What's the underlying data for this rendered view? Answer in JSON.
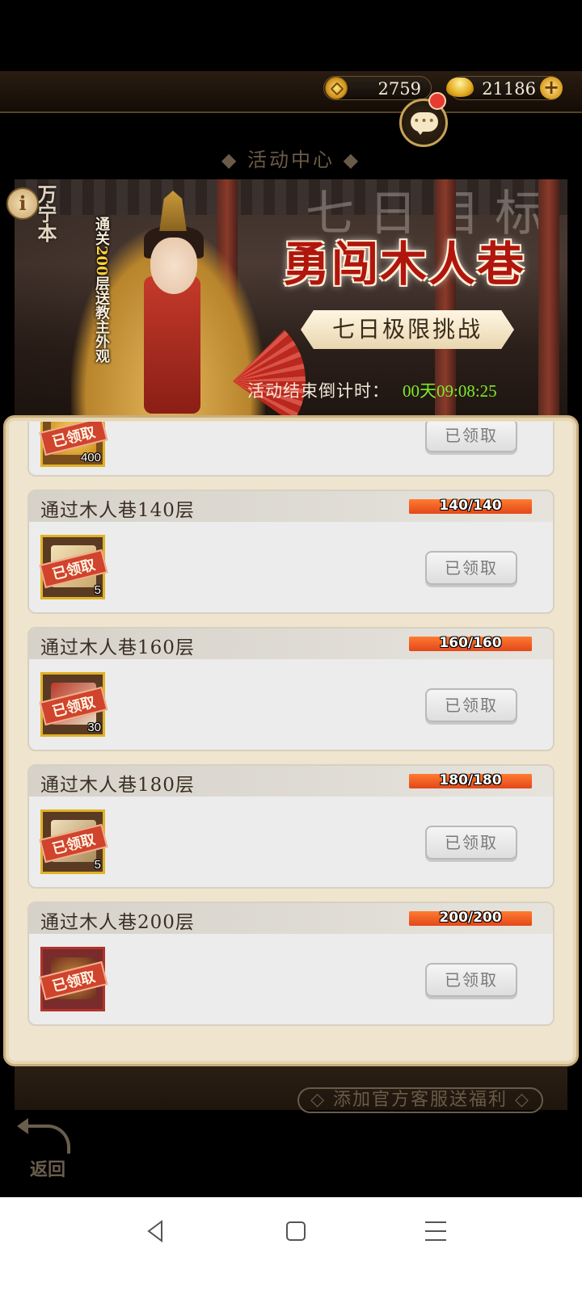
{
  "header": {
    "coins": "2759",
    "ingots": "21186",
    "section_title": "◆ 活动中心 ◆"
  },
  "banner": {
    "promo_vertical_a": "通关",
    "promo_vertical_hl": "200",
    "promo_vertical_b": "层送教主外观",
    "title": "勇闯木人巷",
    "subtitle": "七日极限挑战",
    "countdown_label": "活动结束倒计时：",
    "countdown_value": "00天09:08:25",
    "info_icon": "i"
  },
  "tasks": [
    {
      "name": "",
      "progress": "",
      "qty": "400",
      "stamp": "已领取",
      "button": "已领取"
    },
    {
      "name": "通过木人巷140层",
      "progress": "140/140",
      "qty": "5",
      "stamp": "已领取",
      "button": "已领取"
    },
    {
      "name": "通过木人巷160层",
      "progress": "160/160",
      "qty": "30",
      "stamp": "已领取",
      "button": "已领取"
    },
    {
      "name": "通过木人巷180层",
      "progress": "180/180",
      "qty": "5",
      "stamp": "已领取",
      "button": "已领取"
    },
    {
      "name": "通过木人巷200层",
      "progress": "200/200",
      "qty": "",
      "stamp": "已领取",
      "button": "已领取"
    }
  ],
  "footer": {
    "service_text": "◇ 添加官方客服送福利 ◇",
    "back_label": "返回"
  },
  "icons": {
    "coin": "coin-icon",
    "ingot": "gold-ingot-icon",
    "plus": "plus-icon",
    "chat": "chat-icon",
    "info": "info-icon",
    "back": "back-arrow-icon"
  },
  "colors": {
    "event_title": "#b0160e",
    "countdown_time": "#7eea2c",
    "progress_bar": "#e8551e",
    "stamp": "#d0432c"
  }
}
